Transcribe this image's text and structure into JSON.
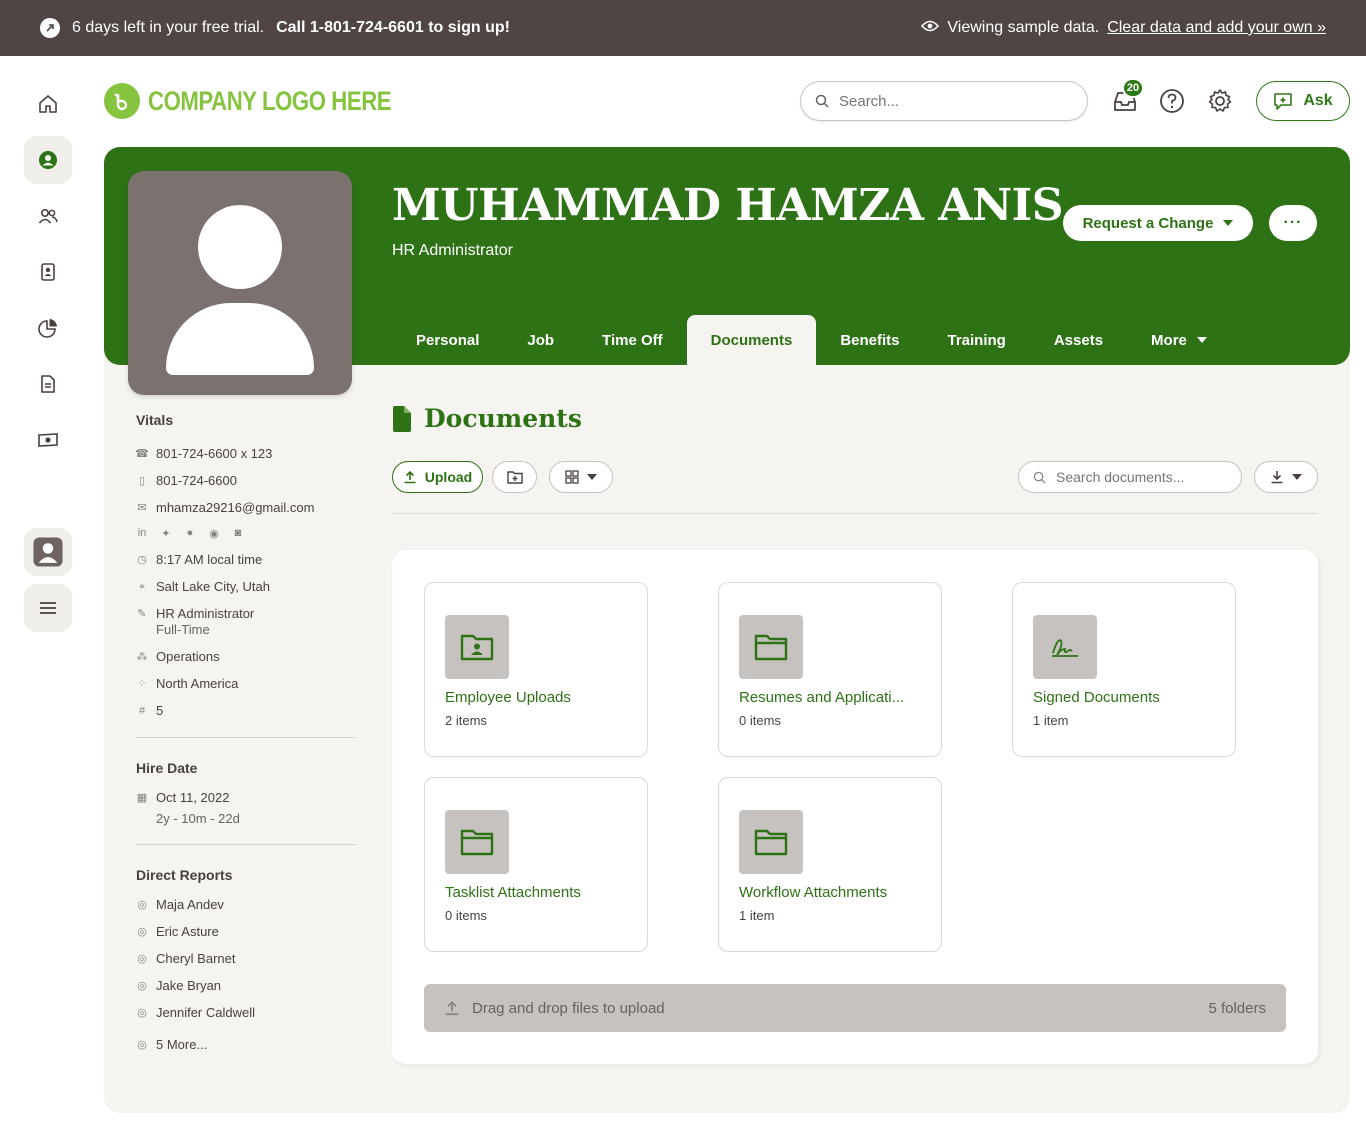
{
  "trial_bar": {
    "days_left": "6 days left in your free trial.",
    "call_text": "Call 1-801-724-6601 to sign up!",
    "viewing": "Viewing sample data.",
    "clear_link": "Clear data and add your own »"
  },
  "header": {
    "logo_text": "COMPANY LOGO HERE",
    "search_placeholder": "Search...",
    "inbox_count": "20",
    "ask_label": "Ask"
  },
  "employee": {
    "name": "MUHAMMAD HAMZA ANIS",
    "title": "HR Administrator",
    "request_change": "Request a Change",
    "more_dots": "···"
  },
  "tabs": [
    {
      "label": "Personal"
    },
    {
      "label": "Job"
    },
    {
      "label": "Time Off"
    },
    {
      "label": "Documents"
    },
    {
      "label": "Benefits"
    },
    {
      "label": "Training"
    },
    {
      "label": "Assets"
    },
    {
      "label": "More"
    }
  ],
  "vitals": {
    "heading": "Vitals",
    "work_phone": "801-724-6600 x 123",
    "mobile_phone": "801-724-6600",
    "email": "mhamza29216@gmail.com",
    "local_time": "8:17 AM local time",
    "location": "Salt Lake City, Utah",
    "job_title": "HR Administrator",
    "employment_type": "Full-Time",
    "department": "Operations",
    "division": "North America",
    "employee_number": "5"
  },
  "hire_date": {
    "heading": "Hire Date",
    "date": "Oct 11, 2022",
    "tenure": "2y - 10m - 22d"
  },
  "direct_reports": {
    "heading": "Direct Reports",
    "people": [
      "Maja Andev",
      "Eric Asture",
      "Cheryl Barnet",
      "Jake Bryan",
      "Jennifer Caldwell"
    ],
    "more": "5 More..."
  },
  "documents": {
    "title": "Documents",
    "upload_label": "Upload",
    "search_placeholder": "Search documents...",
    "folders": [
      {
        "name": "Employee Uploads",
        "count": "2 items",
        "icon": "folder-user-icon"
      },
      {
        "name": "Resumes and Applicati...",
        "count": "0 items",
        "icon": "folder-icon"
      },
      {
        "name": "Signed Documents",
        "count": "1 item",
        "icon": "signature-icon"
      },
      {
        "name": "Tasklist Attachments",
        "count": "0 items",
        "icon": "folder-icon"
      },
      {
        "name": "Workflow Attachments",
        "count": "1 item",
        "icon": "folder-icon"
      }
    ],
    "dropzone_text": "Drag and drop files to upload",
    "folder_count": "5 folders"
  },
  "colors": {
    "brand_green": "#2e7216",
    "logo_green": "#86c440",
    "trial_bar_bg": "#4f4542"
  }
}
